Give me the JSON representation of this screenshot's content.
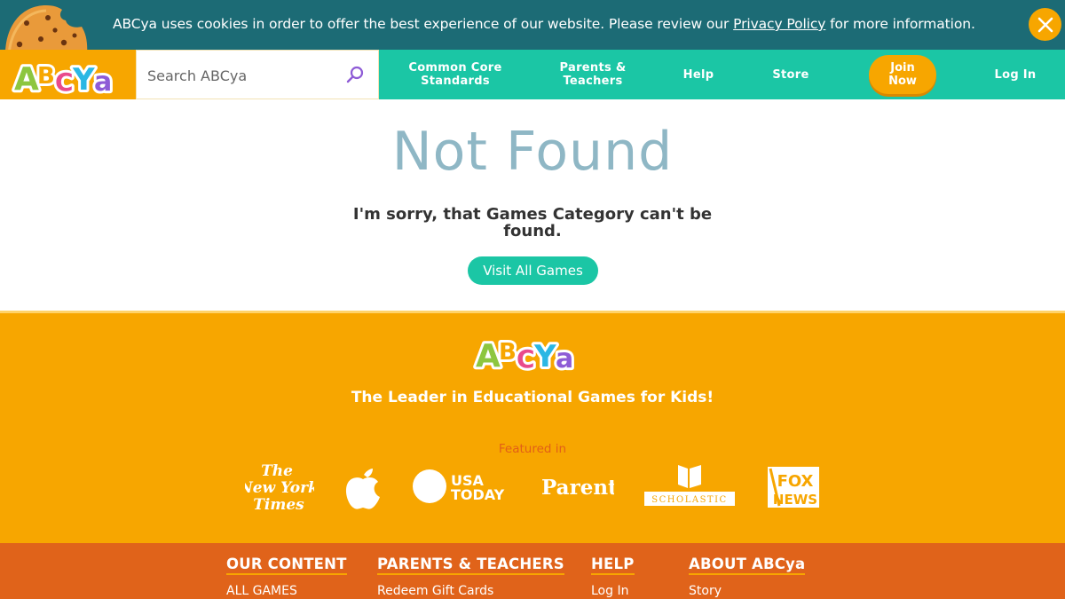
{
  "cookie_banner": {
    "text_before": "ABCya uses cookies in order to offer the best experience of our website. Please review our ",
    "link_text": "Privacy Policy",
    "text_after": " for more information."
  },
  "brand": {
    "logo_text": "ABCya",
    "colors": {
      "teal": "#1bc6a5",
      "orange": "#f7a600",
      "dark_teal": "#1c6b75",
      "footer_orange": "#e0631a"
    }
  },
  "nav": {
    "search_placeholder": "Search ABCya",
    "items": [
      {
        "line1": "Common Core",
        "line2": "Standards"
      },
      {
        "line1": "Parents &",
        "line2": "Teachers"
      },
      {
        "line1": "Help",
        "line2": ""
      },
      {
        "line1": "Store",
        "line2": ""
      }
    ],
    "join": {
      "line1": "Join",
      "line2": "Now"
    },
    "login": "Log In"
  },
  "main": {
    "title": "Not Found",
    "message": "I'm sorry, that Games Category can't be found.",
    "button": "Visit All Games"
  },
  "footer": {
    "tagline": "The Leader in Educational Games for Kids!",
    "featured_label": "Featured in",
    "press": [
      {
        "name": "The New York Times",
        "icon": "nyt-logo"
      },
      {
        "name": "Apple",
        "icon": "apple-logo"
      },
      {
        "name": "USA TODAY",
        "icon": "usa-today-logo"
      },
      {
        "name": "Parents",
        "icon": "parents-logo"
      },
      {
        "name": "SCHOLASTIC",
        "icon": "scholastic-logo"
      },
      {
        "name": "FOX NEWS",
        "icon": "fox-news-logo"
      }
    ],
    "columns": [
      {
        "heading": "OUR CONTENT",
        "first_link": "ALL GAMES"
      },
      {
        "heading": "PARENTS & TEACHERS",
        "first_link": "Redeem Gift Cards"
      },
      {
        "heading": "HELP",
        "first_link": "Log In"
      },
      {
        "heading": "ABOUT ABCya",
        "first_link": "Story"
      }
    ]
  }
}
